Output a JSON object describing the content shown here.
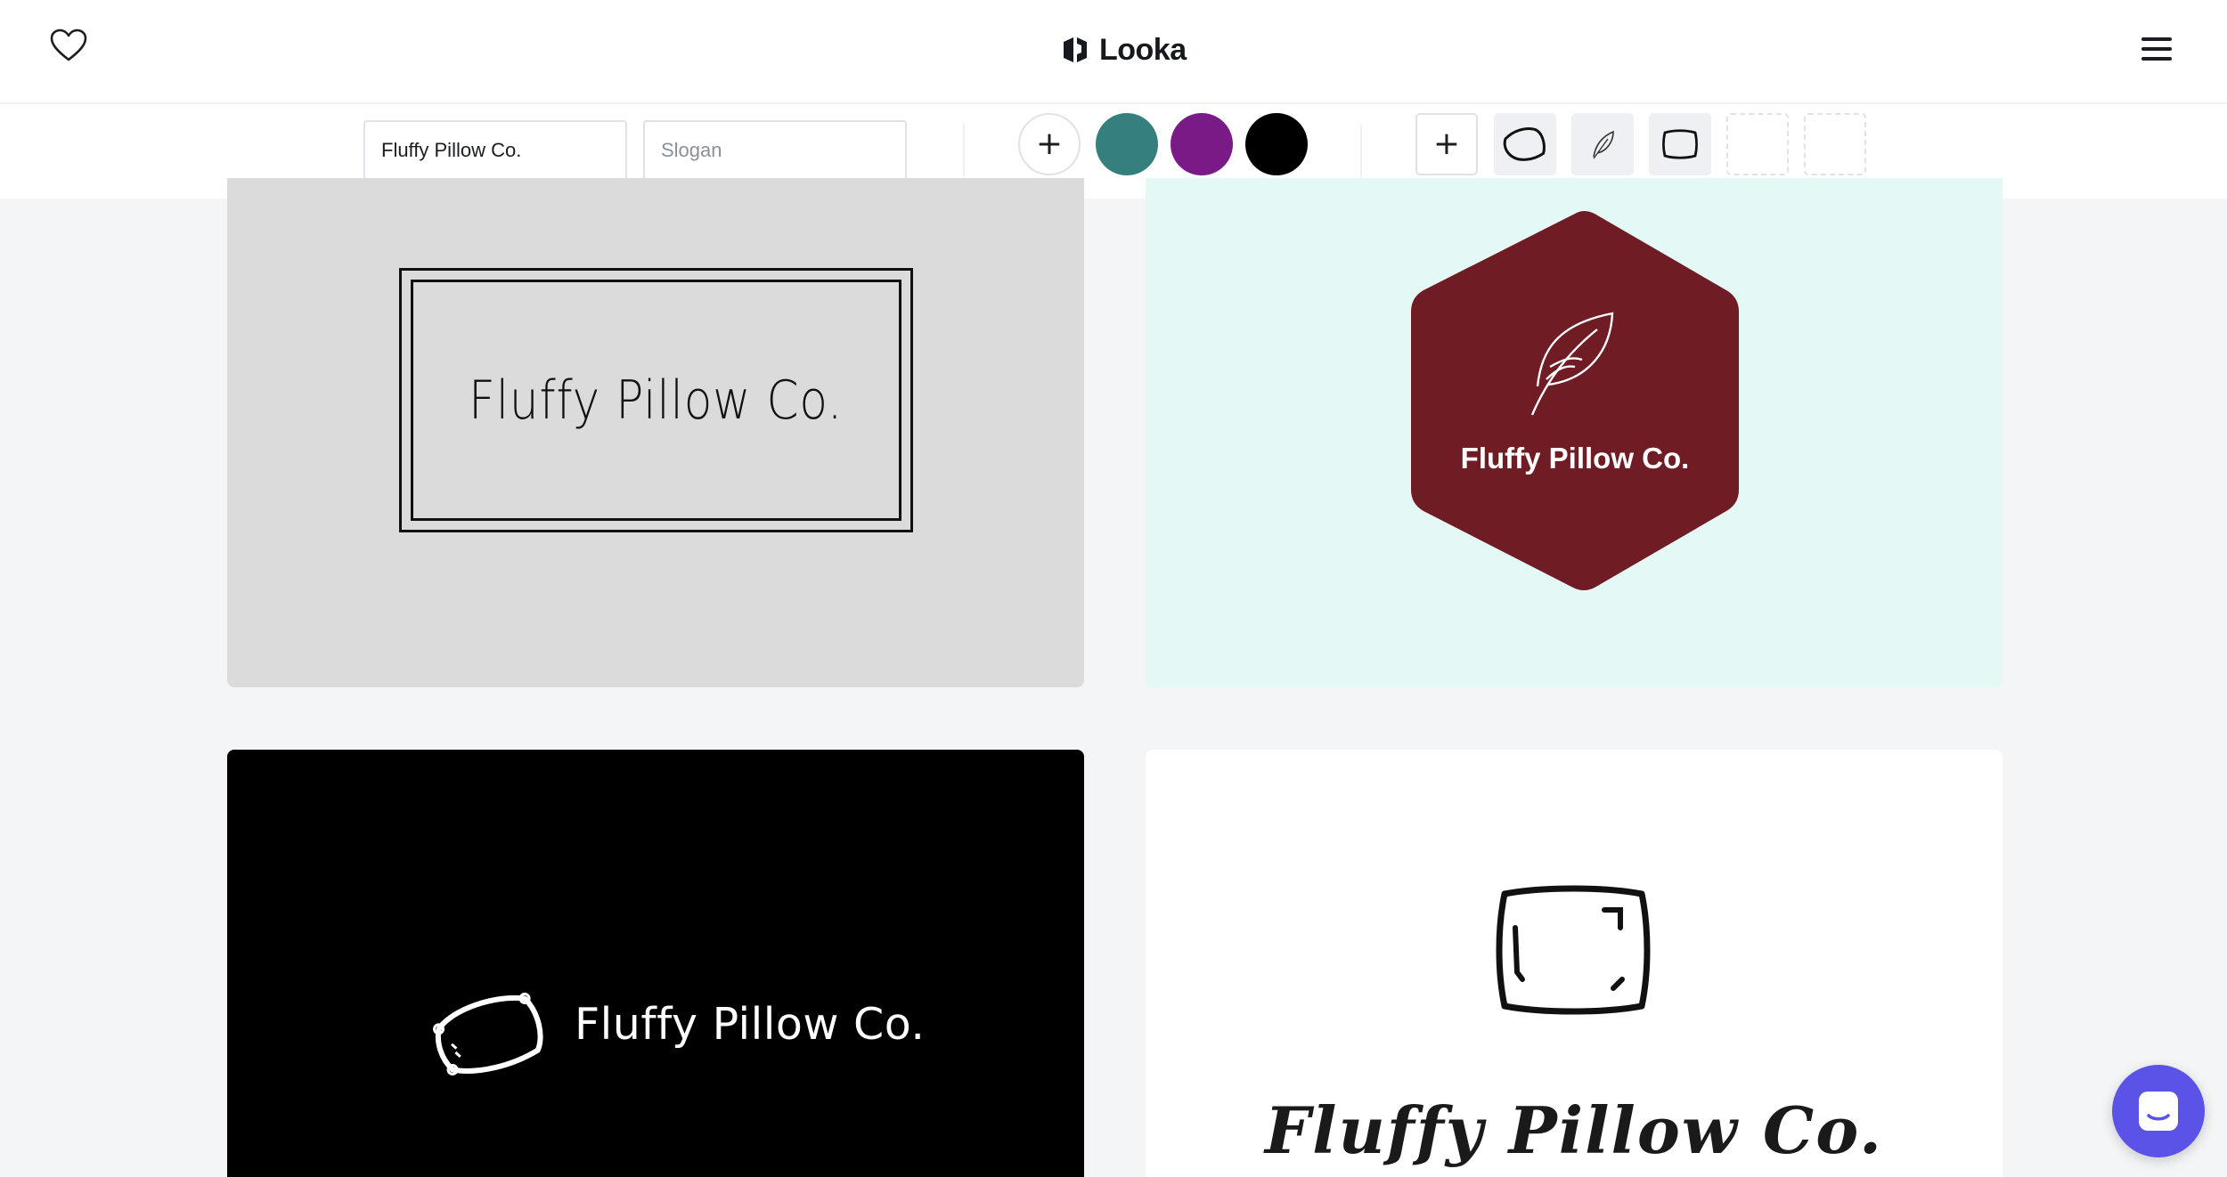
{
  "header": {
    "brand": "Looka",
    "favorites_icon": "heart-icon",
    "menu_icon": "hamburger-icon"
  },
  "toolbar": {
    "company_name_value": "Fluffy Pillow Co.",
    "slogan_placeholder": "Slogan",
    "add_color_icon": "plus-icon",
    "colors": [
      "#35807f",
      "#7a1a86",
      "#000000"
    ],
    "add_symbol_icon": "plus-icon",
    "symbols": [
      "pillow-icon",
      "feather-icon",
      "cushion-icon",
      "empty-slot",
      "empty-slot"
    ]
  },
  "logos": [
    {
      "text": "Fluffy Pillow Co.",
      "background": "#dbdbdb",
      "style": "double-frame"
    },
    {
      "text": "Fluffy Pillow Co.",
      "background": "#e4f8f5",
      "shape_color": "#6f1c24",
      "icon": "feather-icon",
      "style": "hexagon-badge"
    },
    {
      "text": "Fluffy Pillow Co.",
      "background": "#000000",
      "icon": "pillow-icon",
      "style": "icon-left"
    },
    {
      "text": "Fluffy Pillow Co.",
      "background": "#ffffff",
      "icon": "cushion-icon",
      "style": "icon-top"
    }
  ],
  "chat": {
    "icon": "chat-icon",
    "color": "#5b53e8"
  }
}
